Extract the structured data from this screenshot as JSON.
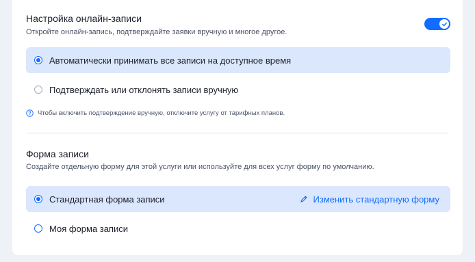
{
  "online_booking": {
    "title": "Настройка онлайн-записи",
    "subtitle": "Откройте онлайн-запись, подтверждайте заявки вручную и многое другое.",
    "toggle_on": true,
    "options": [
      {
        "label": "Автоматически принимать все записи на доступное время",
        "selected": true
      },
      {
        "label": "Подтверждать или отклонять записи вручную",
        "selected": false
      }
    ],
    "hint_icon": "question-circle-icon",
    "hint": "Чтобы включить подтверждение вручную, отключите услугу от тарифных планов."
  },
  "booking_form": {
    "title": "Форма записи",
    "subtitle": "Создайте отдельную форму для этой услуги или используйте для всех услуг форму по умолчанию.",
    "options": [
      {
        "label": "Стандартная форма записи",
        "selected": true
      },
      {
        "label": "Моя форма записи",
        "selected": false
      }
    ],
    "edit_icon": "pencil-icon",
    "edit_link": "Изменить стандартную форму"
  },
  "colors": {
    "accent": "#116dff",
    "selected_bg": "#dbe7fd",
    "page_bg": "#eef1f6"
  }
}
